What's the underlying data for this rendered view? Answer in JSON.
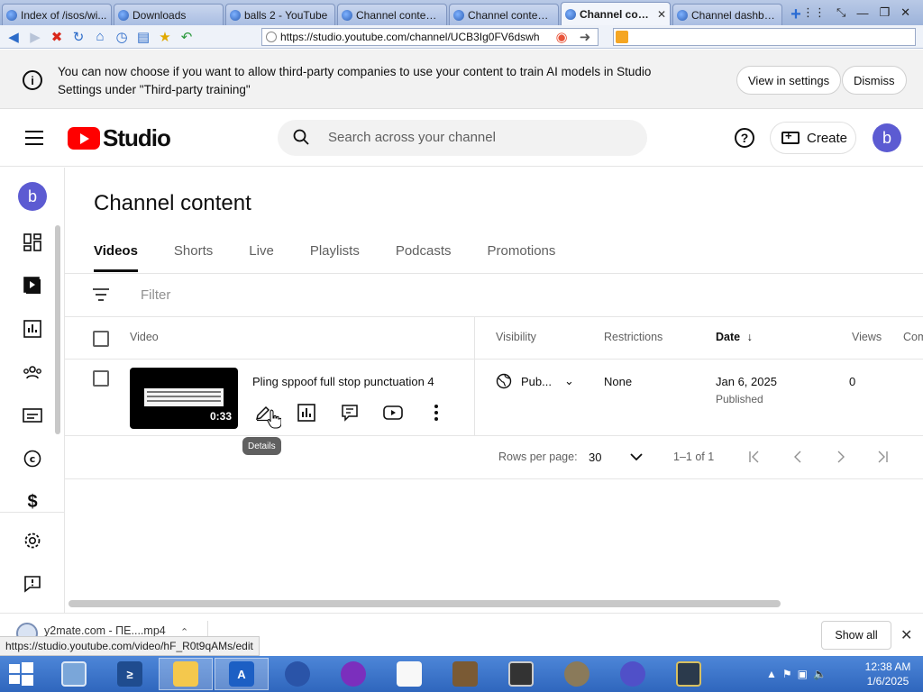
{
  "browser": {
    "tabs": [
      {
        "label": "Index of /isos/wi...",
        "active": false
      },
      {
        "label": "Downloads",
        "active": false
      },
      {
        "label": "balls 2 - YouTube",
        "active": false
      },
      {
        "label": "Channel content ...",
        "active": false
      },
      {
        "label": "Channel content ...",
        "active": false
      },
      {
        "label": "Channel cont...",
        "active": true
      },
      {
        "label": "Channel dashboa...",
        "active": false
      }
    ],
    "url": "https://studio.youtube.com/channel/UCB3Ig0FV6dswh"
  },
  "banner": {
    "text": "You can now choose if you want to allow third-party companies to use your content to train AI models in Studio Settings under \"Third-party training\"",
    "view_settings": "View in settings",
    "dismiss": "Dismiss"
  },
  "header": {
    "logo_text": "Studio",
    "search_placeholder": "Search across your channel",
    "create_label": "Create",
    "avatar_letter": "b"
  },
  "sidebar": {
    "avatar_letter": "b",
    "items": [
      "dashboard-icon",
      "content-icon",
      "analytics-icon",
      "community-icon",
      "subtitles-icon",
      "copyright-icon",
      "earn-icon",
      "settings-icon",
      "feedback-icon"
    ]
  },
  "main": {
    "title": "Channel content",
    "tabs": [
      "Videos",
      "Shorts",
      "Live",
      "Playlists",
      "Podcasts",
      "Promotions"
    ],
    "filter_placeholder": "Filter",
    "columns": {
      "video": "Video",
      "visibility": "Visibility",
      "restrictions": "Restrictions",
      "date": "Date",
      "views": "Views",
      "comments": "Com"
    },
    "row": {
      "title": "Pling sppoof full stop punctuation 4",
      "duration": "0:33",
      "visibility": "Pub...",
      "restrictions": "None",
      "date": "Jan 6, 2025",
      "date_status": "Published",
      "views": "0"
    },
    "tooltip": "Details",
    "pager": {
      "rows_label": "Rows per page:",
      "rows_value": "30",
      "range": "1–1 of 1"
    }
  },
  "downloads": {
    "file": "y2mate.com - ПЕ....mp4",
    "show_all": "Show all"
  },
  "status_url": "https://studio.youtube.com/video/hF_R0t9qAMs/edit",
  "taskbar": {
    "time": "12:38 AM",
    "date": "1/6/2025"
  },
  "colors": {
    "accent_red": "#ff0000",
    "avatar": "#5c5bd2"
  }
}
